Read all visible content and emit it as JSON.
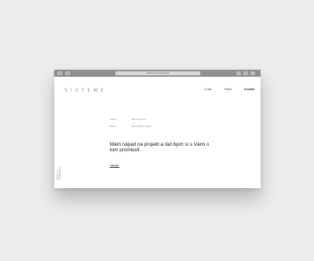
{
  "browser": {
    "url": "sixteme.cz/kontakt"
  },
  "site": {
    "logo": "SIXTEME",
    "nav": [
      "O nás",
      "Práce",
      "Kontakt"
    ]
  },
  "form": {
    "fields": [
      {
        "label": "Jméno",
        "placeholder": "Vaše celé jméno"
      },
      {
        "label": "Email",
        "placeholder": "Váše emailová adresa"
      }
    ],
    "headline": "Mám nápad na projekt a rád bych si s Vámi o tom promluvil.",
    "submit_label": "odeslat"
  },
  "sidebar": {
    "line1": "Sixteme s.r.o.",
    "line2": "info@sixteme.cz"
  },
  "colors": {
    "chrome": "#8f8f8f",
    "background": "#ececec",
    "text": "#111111"
  }
}
